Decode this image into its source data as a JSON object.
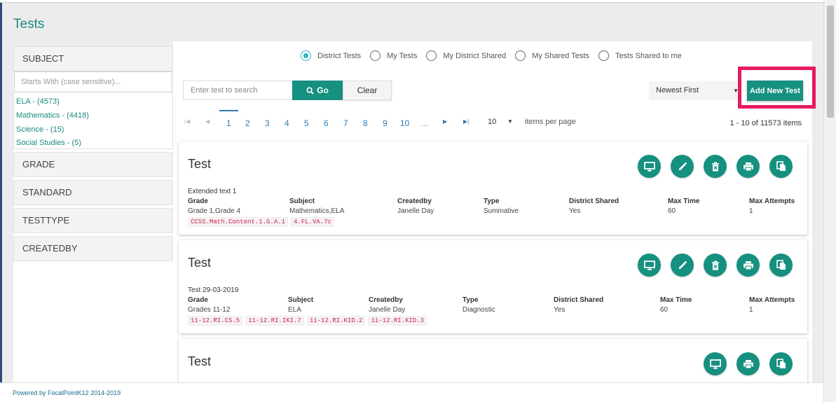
{
  "page": {
    "title": "Tests"
  },
  "sidebar": {
    "facets": {
      "subject": "SUBJECT",
      "grade": "GRADE",
      "standard": "STANDARD",
      "testtype": "TESTTYPE",
      "createdby": "CREATEDBY"
    },
    "filter_placeholder": "Starts With (case sensitive)...",
    "subject_items": [
      "ELA - (4573)",
      "Mathematics - (4418)",
      "Science - (15)",
      "Social Studies - (5)"
    ]
  },
  "filters": {
    "radios": [
      {
        "label": "District Tests",
        "selected": true
      },
      {
        "label": "My Tests",
        "selected": false
      },
      {
        "label": "My District Shared",
        "selected": false
      },
      {
        "label": "My Shared Tests",
        "selected": false
      },
      {
        "label": "Tests Shared to me",
        "selected": false
      }
    ]
  },
  "toolbar": {
    "search_placeholder": "Enter text to search",
    "go_label": "Go",
    "clear_label": "Clear",
    "sort_value": "Newest First",
    "add_label": "Add New Test"
  },
  "pager": {
    "pages": [
      "1",
      "2",
      "3",
      "4",
      "5",
      "6",
      "7",
      "8",
      "9",
      "10",
      "..."
    ],
    "current_page": "1",
    "page_size": "10",
    "items_per_page_label": "items per page",
    "count_text": "1 - 10 of 11573 items"
  },
  "tests": [
    {
      "title": "Test",
      "extra": "Extended text 1",
      "columns": [
        {
          "header": "Grade",
          "value": "Grade 1,Grade 4"
        },
        {
          "header": "Subject",
          "value": "Mathematics,ELA"
        },
        {
          "header": "Createdby",
          "value": "Janelle Day"
        },
        {
          "header": "Type",
          "value": "Summative"
        },
        {
          "header": "District Shared",
          "value": "Yes"
        },
        {
          "header": "Max Time",
          "value": "60"
        },
        {
          "header": "Max Attempts",
          "value": "1"
        }
      ],
      "tags": [
        "CCSS.Math.Content.1.G.A.1",
        "4.FL.VA.7c"
      ],
      "actions": [
        "monitor-icon",
        "edit-icon",
        "delete-icon",
        "print-icon",
        "copy-icon"
      ]
    },
    {
      "title": "Test",
      "extra": "Test 29-03-2019",
      "columns": [
        {
          "header": "Grade",
          "value": "Grades 11-12"
        },
        {
          "header": "Subject",
          "value": "ELA"
        },
        {
          "header": "Createdby",
          "value": "Janelle Day"
        },
        {
          "header": "Type",
          "value": "Diagnostic"
        },
        {
          "header": "District Shared",
          "value": "Yes"
        },
        {
          "header": "Max Time",
          "value": "60"
        },
        {
          "header": "Max Attempts",
          "value": "1"
        }
      ],
      "tags": [
        "11-12.RI.CS.5",
        "11-12.RI.IKI.7",
        "11-12.RI.KID.2",
        "11-12.RI.KID.3"
      ],
      "actions": [
        "monitor-icon",
        "edit-icon",
        "delete-icon",
        "print-icon",
        "copy-icon"
      ]
    },
    {
      "title": "Test",
      "actions": [
        "monitor-icon",
        "print-icon",
        "copy-icon"
      ]
    }
  ],
  "footer": {
    "text": "Powered by FocalPointK12 2014-2019"
  },
  "colors": {
    "accent": "#16907f",
    "highlight": "#e8195e",
    "radio": "#29b6c8",
    "link": "#2c7ab5",
    "tag": "#c6254e"
  }
}
